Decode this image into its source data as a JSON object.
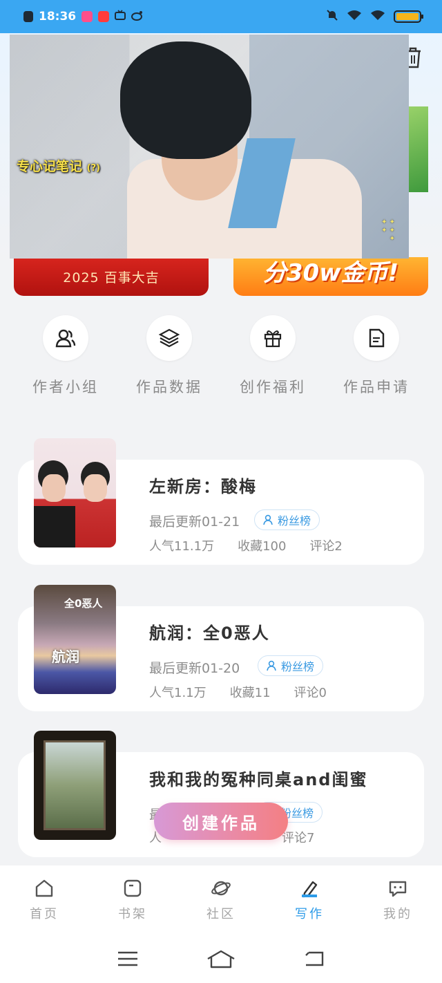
{
  "status_bar": {
    "time": "18:36"
  },
  "video": {
    "subtitle": "专心记笔记",
    "subtitle_mark": "(?)"
  },
  "banners": {
    "left_text": "2025 百事大吉",
    "right_text": "分30w金币!"
  },
  "quick_menu": [
    {
      "label": "作者小组",
      "icon": "people-icon"
    },
    {
      "label": "作品数据",
      "icon": "layers-icon"
    },
    {
      "label": "创作福利",
      "icon": "gift-icon"
    },
    {
      "label": "作品申请",
      "icon": "document-icon"
    }
  ],
  "works": [
    {
      "title": "左新房：酸梅",
      "updated": "最后更新01-21",
      "badge": "粉丝榜",
      "popularity": "人气11.1万",
      "favorites": "收藏100",
      "comments": "评论2"
    },
    {
      "title": "航润：全0恶人",
      "updated": "最后更新01-20",
      "badge": "粉丝榜",
      "popularity": "人气1.1万",
      "favorites": "收藏11",
      "comments": "评论0",
      "cover_text_top": "全0恶人",
      "cover_text_mid": "航润"
    },
    {
      "title": "我和我的冤种同桌and闺蜜",
      "updated": "最",
      "badge": "粉丝榜",
      "popularity": "人",
      "comments": "评论7"
    }
  ],
  "create_button": "创建作品",
  "bottom_nav": [
    {
      "label": "首页",
      "icon": "home-icon"
    },
    {
      "label": "书架",
      "icon": "bookshelf-icon"
    },
    {
      "label": "社区",
      "icon": "planet-icon"
    },
    {
      "label": "写作",
      "icon": "pen-icon"
    },
    {
      "label": "我的",
      "icon": "chat-icon"
    }
  ],
  "colors": {
    "accent": "#2c9be8",
    "status_bar": "#3aa7f2",
    "create_gradient_end": "#f47f83"
  }
}
